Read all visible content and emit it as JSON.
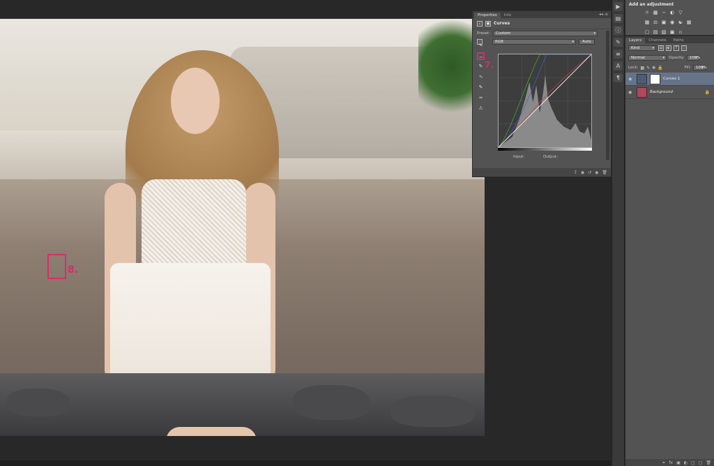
{
  "properties_panel": {
    "tabs": [
      "Properties",
      "Info"
    ],
    "header_title": "Curves",
    "preset_label": "Preset:",
    "preset_value": "Custom",
    "channel_value": "RGB",
    "auto_label": "Auto",
    "input_label": "Input:",
    "output_label": "Output:"
  },
  "annotations": {
    "step7": "7.",
    "step8": "8."
  },
  "adjustments_panel": {
    "title": "Add an adjustment"
  },
  "layers_panel": {
    "tabs": [
      "Layers",
      "Channels",
      "Paths"
    ],
    "kind_label": "Kind",
    "blend_mode": "Normal",
    "opacity_label": "Opacity:",
    "opacity_value": "100%",
    "lock_label": "Lock:",
    "fill_label": "Fill:",
    "fill_value": "100%",
    "layers": [
      {
        "name": "Curves 1"
      },
      {
        "name": "Background"
      }
    ]
  },
  "colors": {
    "annotation": "#d82c6a",
    "selected_layer": "#667389",
    "panel_bg": "#535353"
  }
}
